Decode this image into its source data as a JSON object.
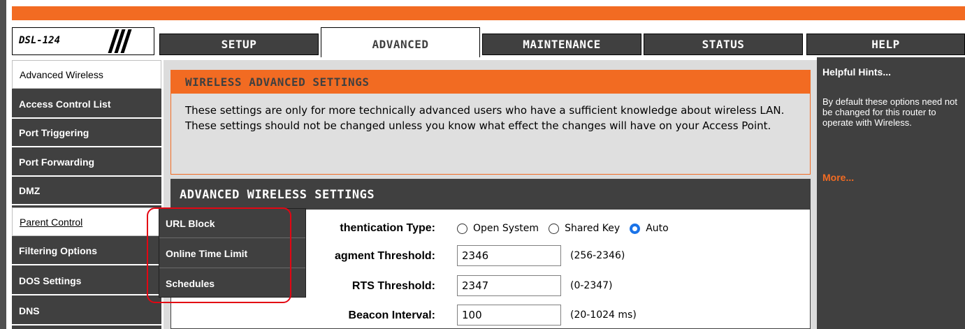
{
  "logo": {
    "model": "DSL-124"
  },
  "tabs": [
    {
      "label": "SETUP",
      "active": false
    },
    {
      "label": "ADVANCED",
      "active": true
    },
    {
      "label": "MAINTENANCE",
      "active": false
    },
    {
      "label": "STATUS",
      "active": false
    },
    {
      "label": "HELP",
      "active": false
    }
  ],
  "sidebar": {
    "items": [
      {
        "label": "Advanced Wireless"
      },
      {
        "label": "Access Control List"
      },
      {
        "label": "Port Triggering"
      },
      {
        "label": "Port Forwarding"
      },
      {
        "label": "DMZ"
      },
      {
        "label": "Parent Control"
      },
      {
        "label": "Filtering Options"
      },
      {
        "label": "DOS Settings"
      },
      {
        "label": "DNS"
      }
    ]
  },
  "submenu": {
    "items": [
      {
        "label": "URL Block"
      },
      {
        "label": "Online Time Limit"
      },
      {
        "label": "Schedules"
      }
    ]
  },
  "warning": {
    "title": "WIRELESS ADVANCED SETTINGS",
    "text": "These settings are only for more technically advanced users who have a sufficient knowledge about wireless LAN. These settings should not be changed unless you know what effect the changes will have on your Access Point."
  },
  "advanced": {
    "title": "ADVANCED WIRELESS SETTINGS",
    "auth_label": "thentication Type:",
    "auth_options": [
      "Open System",
      "Shared Key",
      "Auto"
    ],
    "auth_selected": "Auto",
    "fragment_label": "agment Threshold:",
    "fragment_value": "2346",
    "fragment_hint": "(256-2346)",
    "rts_label": "RTS Threshold:",
    "rts_value": "2347",
    "rts_hint": "(0-2347)",
    "beacon_label": "Beacon Interval:",
    "beacon_value": "100",
    "beacon_hint": "(20-1024 ms)"
  },
  "hints": {
    "title": "Helpful Hints...",
    "body": "By default these options need not be changed for this router to operate with Wireless.",
    "more": "More..."
  },
  "colors": {
    "accent": "#f26b22",
    "dark": "#404040",
    "highlight": "#e30613",
    "radio_selected": "#1a73e8"
  }
}
